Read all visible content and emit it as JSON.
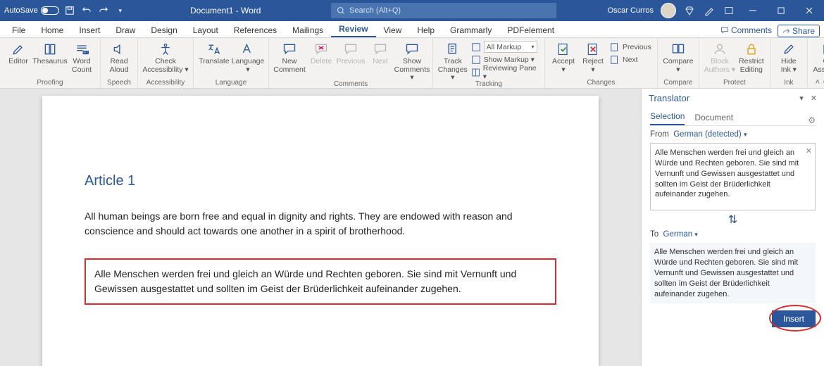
{
  "titlebar": {
    "autosave_label": "AutoSave",
    "autosave_state": "Off",
    "doc_title": "Document1 - Word",
    "search_placeholder": "Search (Alt+Q)",
    "user_name": "Oscar Curros"
  },
  "tabs": {
    "items": [
      "File",
      "Home",
      "Insert",
      "Draw",
      "Design",
      "Layout",
      "References",
      "Mailings",
      "Review",
      "View",
      "Help",
      "Grammarly",
      "PDFelement"
    ],
    "active": "Review",
    "comments": "Comments",
    "share": "Share"
  },
  "ribbon": {
    "proofing": {
      "label": "Proofing",
      "editor": "Editor",
      "thesaurus": "Thesaurus",
      "wordcount": "Word\nCount"
    },
    "speech": {
      "label": "Speech",
      "read": "Read\nAloud"
    },
    "access": {
      "label": "Accessibility",
      "check": "Check\nAccessibility ▾"
    },
    "language": {
      "label": "Language",
      "translate": "Translate",
      "lang": "Language\n▾"
    },
    "comments": {
      "label": "Comments",
      "new": "New\nComment",
      "delete": "Delete",
      "prev": "Previous",
      "next": "Next",
      "show": "Show\nComments ▾"
    },
    "tracking": {
      "label": "Tracking",
      "track": "Track\nChanges ▾",
      "markup": "All Markup",
      "showmarkup": "Show Markup ▾",
      "reviewing": "Reviewing Pane ▾"
    },
    "changes": {
      "label": "Changes",
      "accept": "Accept\n▾",
      "reject": "Reject\n▾",
      "prev": "Previous",
      "next": "Next"
    },
    "compare": {
      "label": "Compare",
      "compare": "Compare\n▾"
    },
    "protect": {
      "label": "Protect",
      "block": "Block\nAuthors ▾",
      "restrict": "Restrict\nEditing"
    },
    "ink": {
      "label": "Ink",
      "hide": "Hide\nInk ▾"
    },
    "cv": {
      "label": "CV",
      "assist": "CV\nAssistant"
    }
  },
  "document": {
    "heading": "Article 1",
    "body": "All human beings are born free and equal in dignity and rights. They are endowed with reason and conscience and should act towards one another in a spirit of brotherhood.",
    "translated": "Alle Menschen werden frei und gleich an Würde und Rechten geboren. Sie sind mit Vernunft und Gewissen ausgestattet und sollten im Geist der Brüderlichkeit aufeinander zugehen."
  },
  "translator": {
    "title": "Translator",
    "tabs": {
      "selection": "Selection",
      "document": "Document"
    },
    "from_label": "From",
    "from_lang": "German (detected)",
    "source_text": "Alle Menschen werden frei und gleich an Würde und Rechten geboren. Sie sind mit Vernunft und Gewissen ausgestattet und sollten im Geist der Brüderlichkeit aufeinander zugehen.",
    "to_label": "To",
    "to_lang": "German",
    "result_text": "Alle Menschen werden frei und gleich an Würde und Rechten geboren. Sie sind mit Vernunft und Gewissen ausgestattet und sollten im Geist der Brüderlichkeit aufeinander zugehen.",
    "insert": "Insert"
  }
}
